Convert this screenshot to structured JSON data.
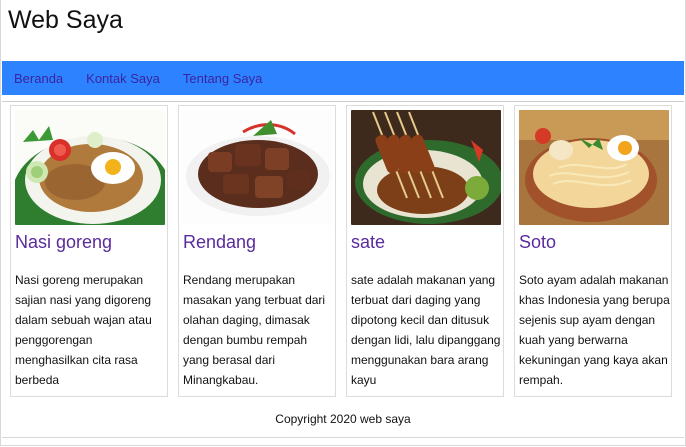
{
  "site": {
    "title": "Web Saya"
  },
  "nav": {
    "items": [
      {
        "label": "Beranda"
      },
      {
        "label": "Kontak Saya"
      },
      {
        "label": "Tentang Saya"
      }
    ]
  },
  "cards": [
    {
      "title": "Nasi goreng",
      "text": "Nasi goreng merupakan sajian nasi yang digoreng dalam sebuah wajan atau penggorengan menghasilkan cita rasa berbeda"
    },
    {
      "title": "Rendang",
      "text": "Rendang merupakan masakan yang terbuat dari olahan daging, dimasak dengan bumbu rempah yang berasal dari Minangkabau."
    },
    {
      "title": "sate",
      "text": "sate adalah makanan yang terbuat dari daging yang dipotong kecil dan ditusuk dengan lidi, lalu dipanggang menggunakan bara arang kayu"
    },
    {
      "title": "Soto",
      "text": "Soto ayam adalah makanan khas Indonesia yang berupa sejenis sup ayam dengan kuah yang berwarna kekuningan yang kaya akan rempah."
    }
  ],
  "footer": {
    "text": "Copyright 2020 web saya"
  },
  "colors": {
    "navbar": "#2d83ff",
    "link": "#3b24a0",
    "card_title": "#5a2b9c"
  }
}
